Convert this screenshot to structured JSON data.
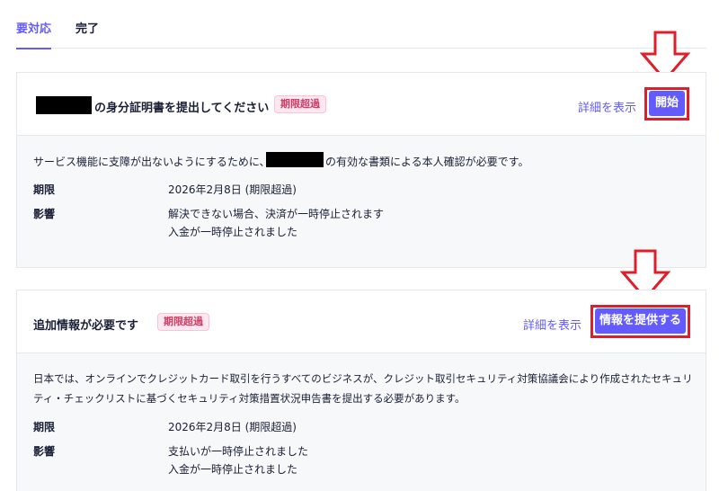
{
  "tabs": {
    "active": "要対応",
    "done": "完了"
  },
  "card1": {
    "title_suffix": "の身分証明書を提出してください",
    "badge": "期限超過",
    "details_link": "詳細を表示",
    "button": "開始",
    "desc_prefix": "サービス機能に支障が出ないようにするために、",
    "desc_suffix": "の有効な書類による本人確認が必要です。",
    "deadline_label": "期限",
    "deadline_value": "2026年2月8日 (期限超過)",
    "impact_label": "影響",
    "impact_line1": "解決できない場合、決済が一時停止されます",
    "impact_line2": "入金が一時停止されました"
  },
  "card2": {
    "title": "追加情報が必要です",
    "badge": "期限超過",
    "details_link": "詳細を表示",
    "button": "情報を提供する",
    "desc_line1": "日本では、オンラインでクレジットカード取引を行うすべてのビジネスが、クレジット取引セキュリティ対策協議会により作成されたセキュリ",
    "desc_line2": "ティ・チェックリストに基づくセキュリティ対策措置状況申告書を提出する必要があります。",
    "deadline_label": "期限",
    "deadline_value": "2026年2月8日 (期限超過)",
    "impact_label": "影響",
    "impact_line1": "支払いが一時停止されました",
    "impact_line2": "入金が一時停止されました"
  },
  "colors": {
    "accent": "#635bff",
    "overdue": "#cd3d64",
    "annotation_red": "#e01e2a"
  }
}
